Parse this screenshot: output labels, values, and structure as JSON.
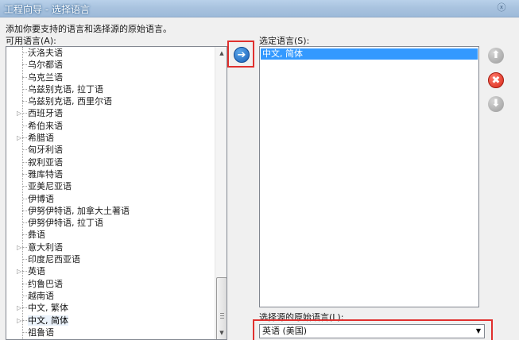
{
  "window": {
    "title": "工程向导 - 选择语言",
    "close_glyph": "ⓧ"
  },
  "instruction": "添加你要支持的语言和选择源的原始语言。",
  "available": {
    "label": "可用语言(A):",
    "items": [
      {
        "label": "沃洛夫语",
        "expandable": false
      },
      {
        "label": "乌尔都语",
        "expandable": false
      },
      {
        "label": "乌克兰语",
        "expandable": false
      },
      {
        "label": "乌兹别克语, 拉丁语",
        "expandable": false
      },
      {
        "label": "乌兹别克语, 西里尔语",
        "expandable": false
      },
      {
        "label": "西班牙语",
        "expandable": true
      },
      {
        "label": "希伯来语",
        "expandable": false
      },
      {
        "label": "希腊语",
        "expandable": true
      },
      {
        "label": "匈牙利语",
        "expandable": false
      },
      {
        "label": "叙利亚语",
        "expandable": false
      },
      {
        "label": "雅库特语",
        "expandable": false
      },
      {
        "label": "亚美尼亚语",
        "expandable": false
      },
      {
        "label": "伊博语",
        "expandable": false
      },
      {
        "label": "伊努伊特语, 加拿大土著语",
        "expandable": false
      },
      {
        "label": "伊努伊特语, 拉丁语",
        "expandable": false
      },
      {
        "label": "彝语",
        "expandable": false
      },
      {
        "label": "意大利语",
        "expandable": true
      },
      {
        "label": "印度尼西亚语",
        "expandable": false
      },
      {
        "label": "英语",
        "expandable": true
      },
      {
        "label": "约鲁巴语",
        "expandable": false
      },
      {
        "label": "越南语",
        "expandable": false
      },
      {
        "label": "中文, 繁体",
        "expandable": true
      },
      {
        "label": "中文, 简体",
        "expandable": true,
        "selected": true
      },
      {
        "label": "祖鲁语",
        "expandable": false
      }
    ]
  },
  "selected": {
    "label": "选定语言(S):",
    "items": [
      "中文, 简体"
    ]
  },
  "source": {
    "label": "选择源的原始语言(L):",
    "value": "英语 (美国)"
  },
  "buttons": {
    "add_glyph": "➔",
    "up_glyph": "⬆",
    "remove_glyph": "✖",
    "down_glyph": "⬇"
  }
}
